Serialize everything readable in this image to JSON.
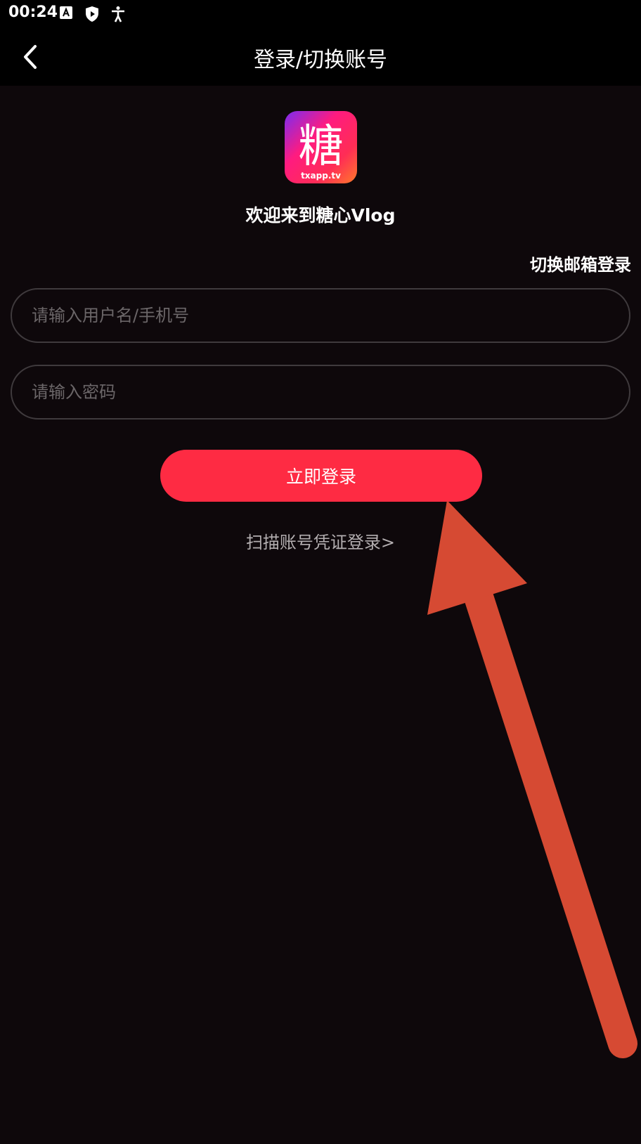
{
  "status_bar": {
    "time": "00:24",
    "icons": [
      "font-a-icon",
      "shield-play-icon",
      "accessibility-icon"
    ]
  },
  "app_bar": {
    "title": "登录/切换账号",
    "back_icon": "chevron-left-icon"
  },
  "logo": {
    "glyph": "糖",
    "caption": "txapp.tv"
  },
  "welcome_text": "欢迎来到糖心Vlog",
  "switch_email_login": "切换邮箱登录",
  "form": {
    "username_placeholder": "请输入用户名/手机号",
    "username_value": "",
    "password_placeholder": "请输入密码",
    "password_value": ""
  },
  "login_button": "立即登录",
  "scan_credential_link": "扫描账号凭证登录>",
  "colors": {
    "background": "#0e080b",
    "accent": "#fe2b43",
    "annotation_arrow": "#d64a33"
  }
}
